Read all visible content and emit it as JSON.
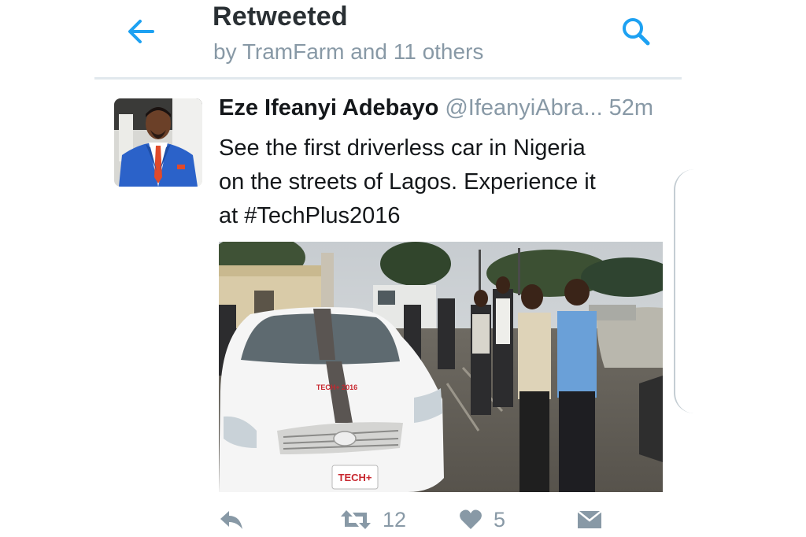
{
  "header": {
    "title": "Retweeted",
    "subtitle": "by TramFarm and 11 others",
    "back_icon": "arrow-left-icon",
    "search_icon": "search-icon",
    "accent_color": "#1da1f2"
  },
  "tweet": {
    "author_name": "Eze Ifeanyi Adebayo",
    "author_handle": "@IfeanyiAbra...",
    "time": "52m",
    "text": "See the first driverless car in Nigeria\non the streets of Lagos. Experience it\nat #TechPlus2016",
    "media": {
      "hood_text": "TECH+ 2016",
      "plate_text": "TECH+"
    }
  },
  "actions": {
    "reply_icon": "reply-icon",
    "retweet_icon": "retweet-icon",
    "retweet_count": "12",
    "like_icon": "heart-icon",
    "like_count": "5",
    "dm_icon": "direct-message-icon",
    "color": "#8899a6"
  }
}
